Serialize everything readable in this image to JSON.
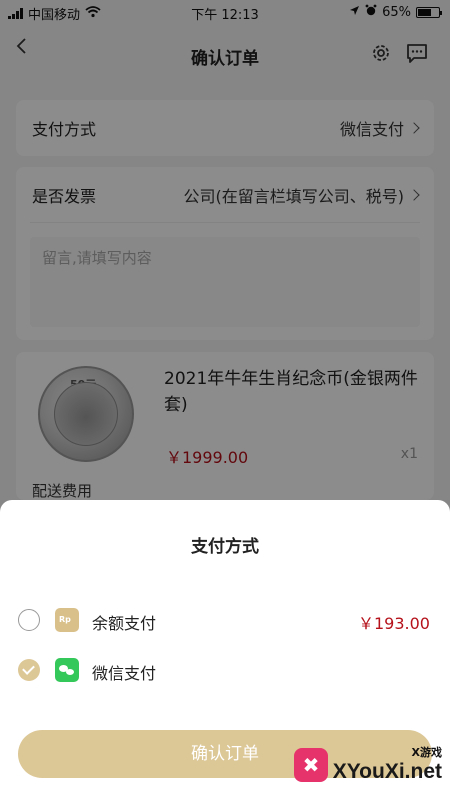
{
  "status_bar": {
    "carrier": "中国移动",
    "time": "下午 12:13",
    "battery": "65%",
    "battery_level": 0.65
  },
  "nav": {
    "title": "确认订单"
  },
  "order": {
    "payment_label": "支付方式",
    "payment_value": "微信支付",
    "invoice_label": "是否发票",
    "invoice_value": "公司(在留言栏填写公司、税号)",
    "memo_placeholder": "留言,请填写内容",
    "product": {
      "coin_face": "50元",
      "title": "2021年牛年生肖纪念币(金银两件套)",
      "price": "￥1999.00",
      "qty": "x1"
    },
    "next_row_peek": "配送费用"
  },
  "sheet": {
    "title": "支付方式",
    "options": [
      {
        "label": "余额支付",
        "amount": "￥193.00",
        "icon": "balance-icon",
        "selected": false
      },
      {
        "label": "微信支付",
        "amount": "",
        "icon": "wechat-icon",
        "selected": true
      }
    ],
    "confirm_label": "确认订单"
  },
  "watermark": {
    "small": "X游戏",
    "main": "XYouXi.net"
  },
  "colors": {
    "accent": "#dcc796",
    "price": "#b5121b",
    "wechat": "#34c759"
  }
}
